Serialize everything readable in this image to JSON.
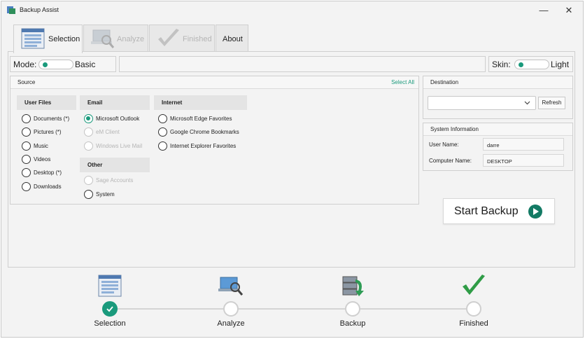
{
  "window": {
    "title": "Backup Assist",
    "minimize": "—",
    "close": "✕"
  },
  "tabs": [
    {
      "label": "Selection",
      "icon": "list-window-icon",
      "state": "active"
    },
    {
      "label": "Analyze",
      "icon": "magnifier-laptop-icon",
      "state": "disabled"
    },
    {
      "label": "Finished",
      "icon": "checkmark-icon",
      "state": "disabled"
    },
    {
      "label": "About",
      "state": "normal"
    }
  ],
  "mode": {
    "label": "Mode:",
    "value": "Basic"
  },
  "skin": {
    "label": "Skin:",
    "value": "Light"
  },
  "source": {
    "title": "Source",
    "select_all": "Select All",
    "user_files": {
      "header": "User Files",
      "items": [
        "Documents (*)",
        "Pictures (*)",
        "Music",
        "Videos",
        "Desktop (*)",
        "Downloads"
      ]
    },
    "email": {
      "header": "Email",
      "items": [
        {
          "label": "Microsoft Outlook",
          "checked": true,
          "disabled": false
        },
        {
          "label": "eM Client",
          "checked": false,
          "disabled": true
        },
        {
          "label": "Windows Live Mail",
          "checked": false,
          "disabled": true
        }
      ]
    },
    "other": {
      "header": "Other",
      "items": [
        {
          "label": "Sage Accounts",
          "disabled": true
        },
        {
          "label": "System",
          "disabled": false
        }
      ]
    },
    "internet": {
      "header": "Internet",
      "items": [
        "Microsoft Edge Favorites",
        "Google Chrome Bookmarks",
        "Internet Explorer Favorites"
      ]
    }
  },
  "destination": {
    "title": "Destination",
    "selected": "",
    "refresh": "Refresh"
  },
  "system_info": {
    "title": "System Information",
    "user_name_label": "User Name:",
    "user_name": "darre",
    "computer_name_label": "Computer Name:",
    "computer_name": "DESKTOP"
  },
  "start_button": {
    "label": "Start Backup"
  },
  "steps": [
    {
      "label": "Selection",
      "done": true
    },
    {
      "label": "Analyze",
      "done": false
    },
    {
      "label": "Backup",
      "done": false
    },
    {
      "label": "Finished",
      "done": false
    }
  ],
  "colors": {
    "accent": "#1a9a7c",
    "start_icon": "#137a64"
  }
}
